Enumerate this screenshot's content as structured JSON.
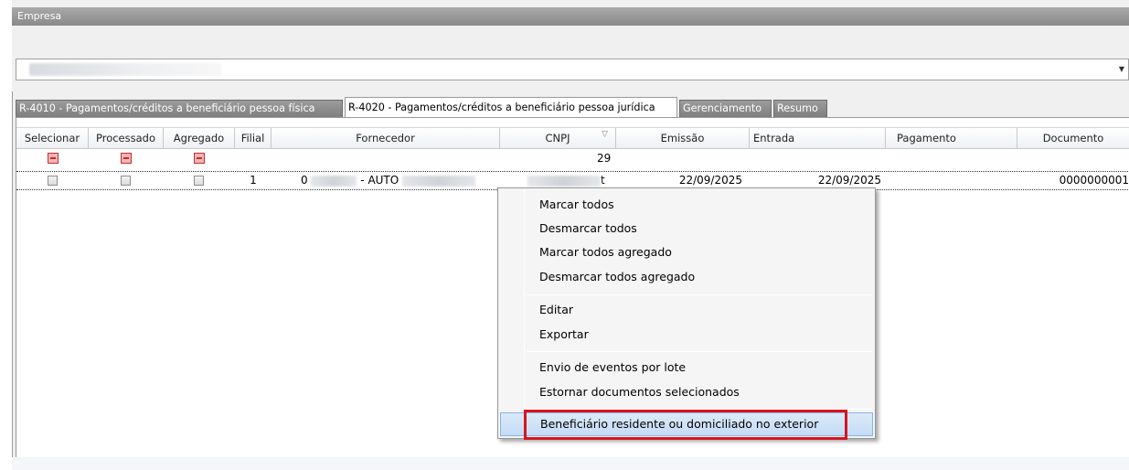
{
  "empresa": {
    "label": "Empresa",
    "value": ""
  },
  "tabs": [
    {
      "label": "R-4010 - Pagamentos/créditos a beneficiário pessoa física",
      "active": false
    },
    {
      "label": "R-4020 - Pagamentos/créditos a beneficiário pessoa jurídica",
      "active": true
    },
    {
      "label": "Gerenciamento",
      "active": false
    },
    {
      "label": "Resumo",
      "active": false
    }
  ],
  "grid": {
    "columns": [
      "Selecionar",
      "Processado",
      "Agregado",
      "Filial",
      "Fornecedor",
      "CNPJ",
      "Emissão",
      "Entrada",
      "Pagamento",
      "Documento"
    ],
    "filter_count": "29",
    "row": {
      "filial": "1",
      "fornecedor_prefix": "0",
      "fornecedor_name": "- AUTO",
      "cnpj_suffix": "t",
      "emissao": "22/09/2025",
      "entrada": "22/09/2025",
      "documento": "0000000001"
    }
  },
  "context_menu": {
    "items": [
      "Marcar todos",
      "Desmarcar todos",
      "Marcar todos agregado",
      "Desmarcar todos agregado",
      "Editar",
      "Exportar",
      "Envio de eventos por lote",
      "Estornar documentos selecionados",
      "Beneficiário residente ou domiciliado no exterior"
    ],
    "highlighted_index": 8
  },
  "colors": {
    "highlight_border": "#d8141e",
    "menu_hover": "#c4dcf5"
  }
}
